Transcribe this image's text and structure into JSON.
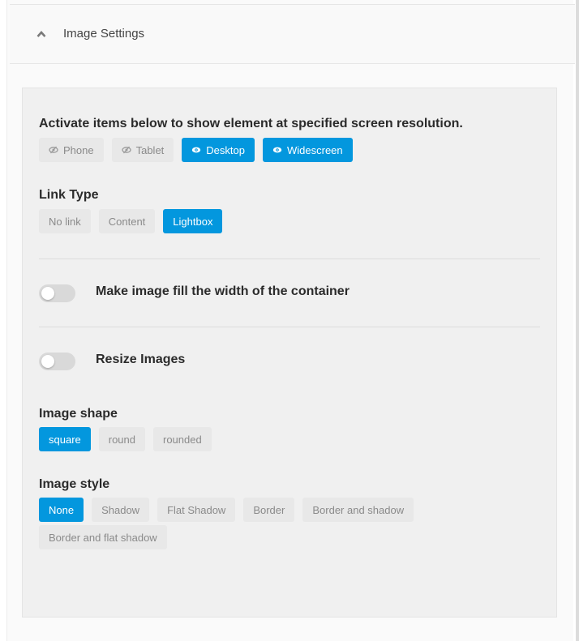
{
  "panel": {
    "title": "Image Settings",
    "collapse_icon": "chevron-up-icon"
  },
  "visibility": {
    "label": "Activate items below to show element at specified screen resolution.",
    "options": [
      {
        "label": "Phone",
        "icon": "eye-slash-icon",
        "active": false
      },
      {
        "label": "Tablet",
        "icon": "eye-slash-icon",
        "active": false
      },
      {
        "label": "Desktop",
        "icon": "eye-icon",
        "active": true
      },
      {
        "label": "Widescreen",
        "icon": "eye-icon",
        "active": true
      }
    ]
  },
  "link_type": {
    "label": "Link Type",
    "options": [
      {
        "label": "No link",
        "active": false
      },
      {
        "label": "Content",
        "active": false
      },
      {
        "label": "Lightbox",
        "active": true
      }
    ]
  },
  "fill_width": {
    "label": "Make image fill the width of the container",
    "enabled": false
  },
  "resize_images": {
    "label": "Resize Images",
    "enabled": false
  },
  "image_shape": {
    "label": "Image shape",
    "options": [
      {
        "label": "square",
        "active": true
      },
      {
        "label": "round",
        "active": false
      },
      {
        "label": "rounded",
        "active": false
      }
    ]
  },
  "image_style": {
    "label": "Image style",
    "options": [
      {
        "label": "None",
        "active": true
      },
      {
        "label": "Shadow",
        "active": false
      },
      {
        "label": "Flat Shadow",
        "active": false
      },
      {
        "label": "Border",
        "active": false
      },
      {
        "label": "Border and shadow",
        "active": false
      },
      {
        "label": "Border and flat shadow",
        "active": false
      }
    ]
  },
  "colors": {
    "accent": "#0397de",
    "inactive_button": "#e8e8e8",
    "panel_background": "#f0f0f0"
  }
}
